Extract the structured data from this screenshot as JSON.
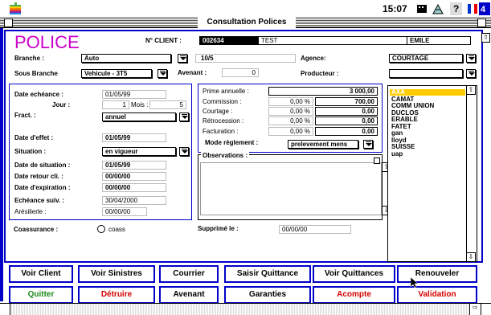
{
  "menubar": {
    "clock": "15:07"
  },
  "window": {
    "title": "Consultation Polices"
  },
  "header": {
    "title": "POLICE",
    "client_label": "N° CLIENT :",
    "client_number": "002634",
    "client_name": "TEST",
    "client_firstname": "EMILE"
  },
  "row1": {
    "branche_label": "Branche :",
    "branche_value": "Auto",
    "n_label": "N°",
    "n_value": "10/5",
    "agence_label": "Agence:",
    "agence_value": "COURTAGE"
  },
  "row2": {
    "sous_branche_label": "Sous Branche",
    "sous_branche_value": "Vehicule - 3T5",
    "avenant_label": "Avenant :",
    "avenant_value": "0",
    "producteur_label": "Producteur :",
    "producteur_value": ""
  },
  "left": {
    "date_echeance_label": "Date echéance :",
    "date_echeance": "01/05/99",
    "jour_label": "Jour :",
    "jour": "1",
    "mois_label": "Mois :",
    "mois": "5",
    "fract_label": "Fract. :",
    "fract": "annuel",
    "date_effet_label": "Date d'effet :",
    "date_effet": "01/05/99",
    "situation_label": "Situation :",
    "situation": "en vigueur",
    "date_situation_label": "Date de situation :",
    "date_situation": "01/05/99",
    "date_retour_label": "Date retour cli. :",
    "date_retour": "00/00/00",
    "date_expiration_label": "Date d'expiration :",
    "date_expiration": "00/00/00",
    "echeance_suiv_label": "Echéance suiv. :",
    "echeance_suiv": "30/04/2000",
    "aresilierle_label": "Arésilierle :",
    "aresilierle": "00/00/00"
  },
  "prime": {
    "prime_label": "Prime annuelle :",
    "prime_value": "3 000,00",
    "commission_label": "Commission :",
    "commission_pct": "0,00 %",
    "commission_value": "700,00",
    "courtage_label": "Courtage :",
    "courtage_pct": "0,00 %",
    "courtage_value": "0,00",
    "retrocession_label": "Rétrocession :",
    "retrocession_pct": "0,00 %",
    "retrocession_value": "0,00",
    "facturation_label": "Facturation :",
    "facturation_pct": "0,00 %",
    "facturation_value": "0,00",
    "mode_label": "Mode règlement :",
    "mode_value": "prelevement mens"
  },
  "observations": {
    "label": "Observations :",
    "text": ""
  },
  "bottom_info": {
    "coassurance_label": "Coassurance :",
    "coass_label": "coass",
    "supprime_label": "Supprimé le :",
    "supprime_value": "00/00/00"
  },
  "companies": [
    "AXA",
    "CAMAT",
    "COMM UNION",
    "DUCLOS",
    "ERABLE",
    "FATET",
    "gan",
    "lloyd",
    "SUISSE",
    "uap"
  ],
  "buttons_row1": [
    "Voir Client",
    "Voir Sinistres",
    "Courrier",
    "Saisir Quittance",
    "Voir Quittances",
    "Renouveler"
  ],
  "buttons_row2": [
    "Quitter",
    "Détruire",
    "Avenant",
    "Garanties",
    "Acompte",
    "Validation"
  ],
  "colors": {
    "frame": "#0000c8",
    "accent_title": "#cc00cc",
    "danger": "#d40000",
    "ok": "#1a8a1a",
    "selection": "#ffcc00"
  }
}
